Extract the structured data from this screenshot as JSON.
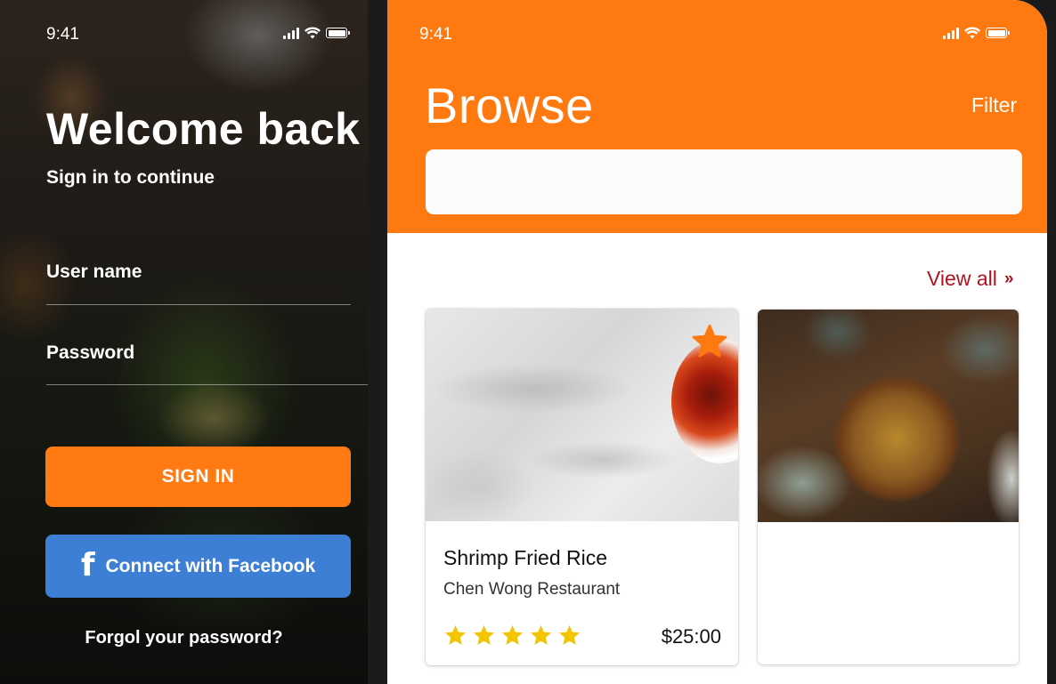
{
  "login": {
    "status_time": "9:41",
    "title": "Welcome back",
    "subtitle": "Sign in to continue",
    "username_label": "User name",
    "password_label": "Password",
    "signin_label": "SIGN IN",
    "facebook_label": "Connect with Facebook",
    "facebook_icon": "f",
    "forgot_label": "Forgol your password?"
  },
  "browse": {
    "status_time": "9:41",
    "title": "Browse",
    "filter_label": "Filter",
    "search_value": "",
    "view_all_label": "View all",
    "view_all_icon": "»",
    "cards": [
      {
        "title": "Shrimp Fried Rice",
        "restaurant": "Chen Wong Restaurant",
        "rating": 5,
        "price": "$25:00",
        "favorite": true
      }
    ]
  },
  "colors": {
    "accent": "#fe7a10",
    "facebook": "#3c7fd4",
    "link": "#b3121f",
    "star": "#f5c400"
  }
}
